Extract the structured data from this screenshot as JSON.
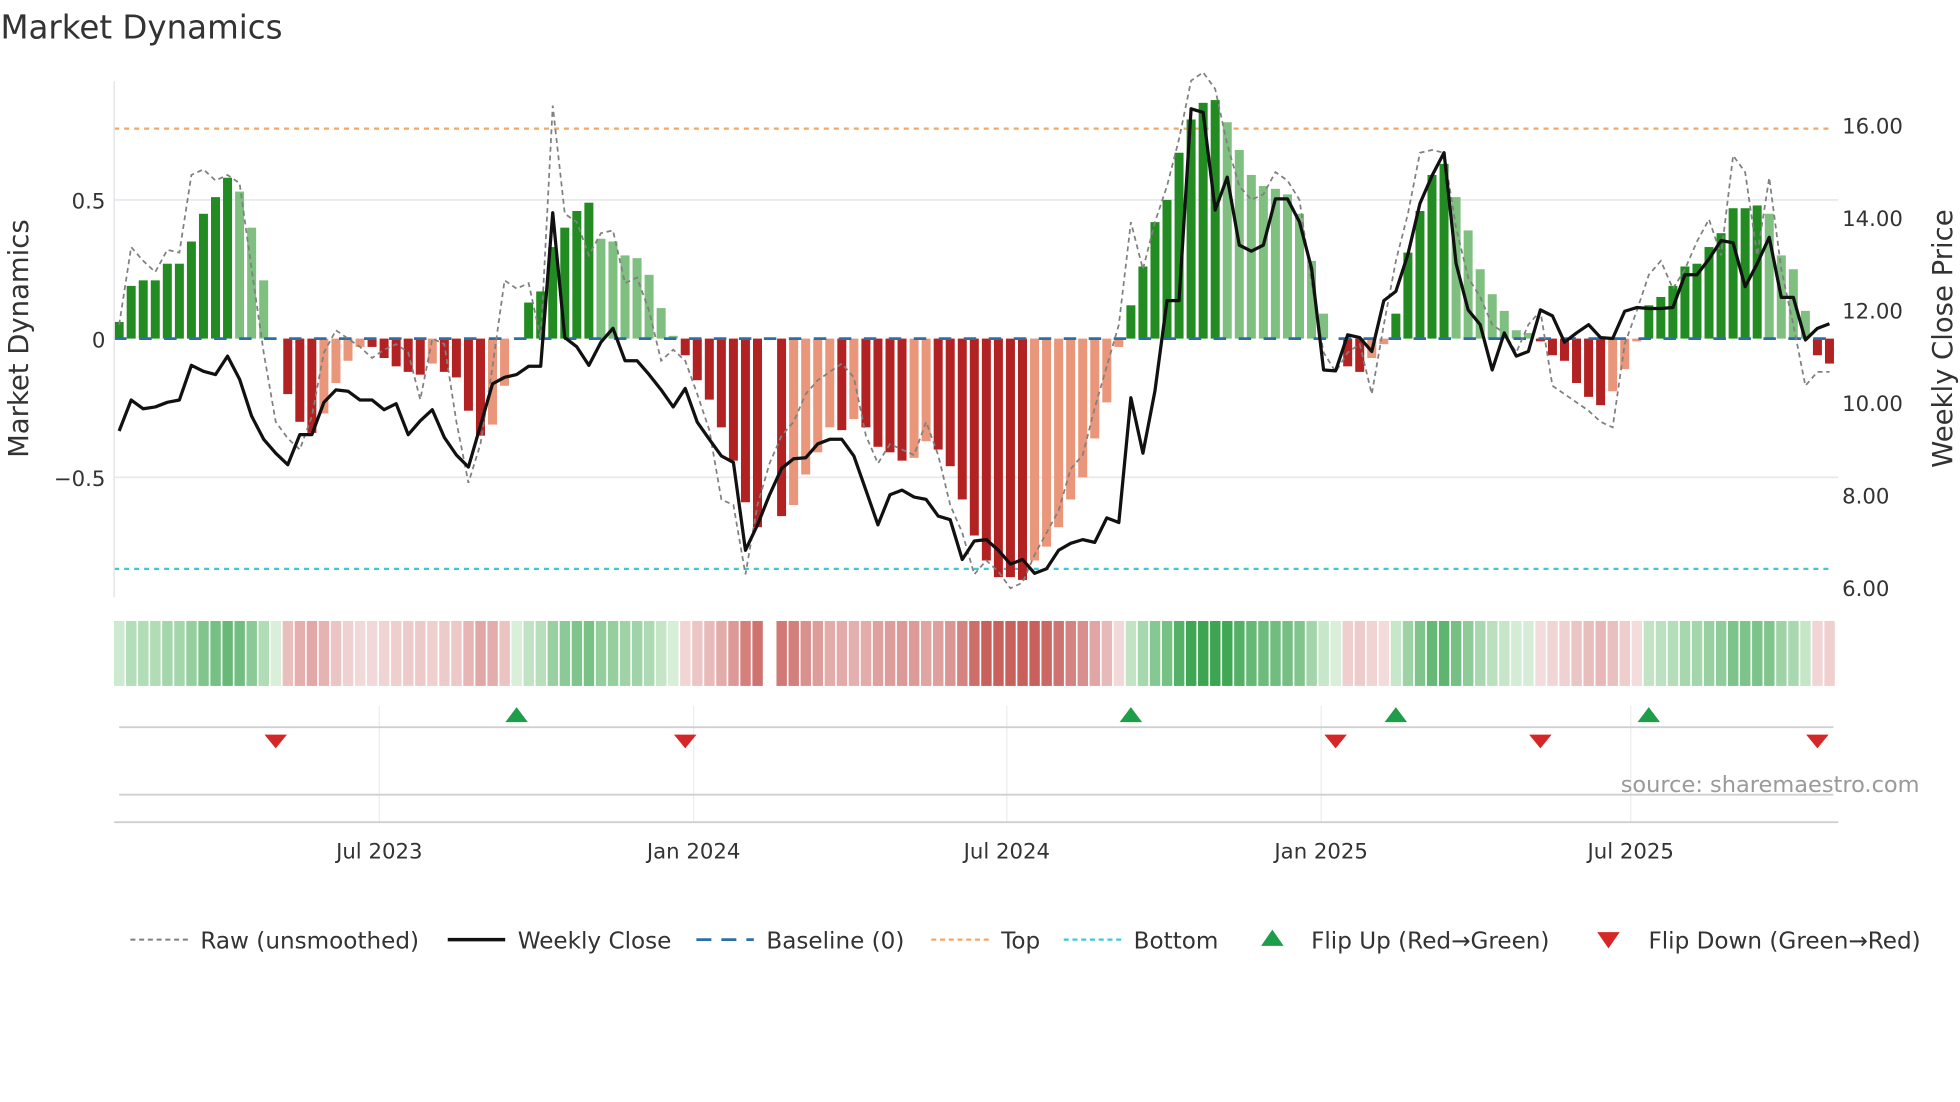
{
  "title": "Market Dynamics",
  "source": "source: sharemaestro.com",
  "colors": {
    "pos_strong": "#228b22",
    "pos_weak": "#7fbf7f",
    "neg_strong": "#b22222",
    "neg_weak": "#e9967a",
    "close": "#111111",
    "raw": "#808080",
    "baseline": "#2a6fa8",
    "top": "#f0a868",
    "bottom": "#3cc8d8",
    "flip_up": "#1f9e4a",
    "flip_down": "#d62728"
  },
  "chart_data": {
    "type": "bar",
    "title": "Market Dynamics",
    "xlabel": "",
    "ylabel": "Market Dynamics",
    "y2label": "Weekly Close Price",
    "x_unit": "week index (weekly, ~Feb 2023 to Oct 2025)",
    "ylim": [
      -0.93,
      0.93
    ],
    "y2lim": [
      5.7,
      17.0
    ],
    "top_level": 0.757,
    "bottom_level": -0.83,
    "baseline": 0,
    "y_ticks": [
      {
        "value": 0.5,
        "label": "0.5"
      },
      {
        "value": 0,
        "label": "0"
      },
      {
        "value": -0.5,
        "label": "−0.5"
      }
    ],
    "y2_ticks": [
      {
        "value": 16,
        "label": "16.00"
      },
      {
        "value": 14,
        "label": "14.00"
      },
      {
        "value": 12,
        "label": "12.00"
      },
      {
        "value": 10,
        "label": "10.00"
      },
      {
        "value": 8,
        "label": "8.00"
      },
      {
        "value": 6,
        "label": "6.00"
      }
    ],
    "x_ticks": [
      {
        "week": 21.6,
        "label": "Jul 2023"
      },
      {
        "week": 47.7,
        "label": "Jan 2024"
      },
      {
        "week": 73.7,
        "label": "Jul 2024"
      },
      {
        "week": 99.8,
        "label": "Jan 2025"
      },
      {
        "week": 125.5,
        "label": "Jul 2025"
      }
    ],
    "dynamics": [
      0.06,
      0.19,
      0.21,
      0.21,
      0.27,
      0.27,
      0.35,
      0.45,
      0.51,
      0.58,
      0.53,
      0.4,
      0.21,
      0,
      -0.2,
      -0.3,
      -0.34,
      -0.27,
      -0.16,
      -0.08,
      -0.03,
      -0.03,
      -0.07,
      -0.1,
      -0.12,
      -0.13,
      -0.09,
      -0.12,
      -0.14,
      -0.26,
      -0.35,
      -0.31,
      -0.17,
      0,
      0.13,
      0.17,
      0.33,
      0.4,
      0.46,
      0.49,
      0.36,
      0.35,
      0.3,
      0.29,
      0.23,
      0.11,
      0.01,
      -0.06,
      -0.15,
      -0.22,
      -0.32,
      -0.44,
      -0.59,
      -0.68,
      null,
      -0.64,
      -0.6,
      -0.49,
      -0.41,
      -0.32,
      -0.33,
      -0.29,
      -0.32,
      -0.39,
      -0.41,
      -0.44,
      -0.43,
      -0.37,
      -0.4,
      -0.46,
      -0.58,
      -0.71,
      -0.8,
      -0.86,
      -0.86,
      -0.87,
      -0.8,
      -0.75,
      -0.68,
      -0.58,
      -0.5,
      -0.36,
      -0.23,
      -0.03,
      0.12,
      0.26,
      0.42,
      0.5,
      0.67,
      0.79,
      0.85,
      0.86,
      0.78,
      0.68,
      0.59,
      0.55,
      0.54,
      0.52,
      0.45,
      0.28,
      0.09,
      0,
      -0.1,
      -0.12,
      -0.07,
      -0.02,
      0.09,
      0.31,
      0.46,
      0.59,
      0.63,
      0.51,
      0.39,
      0.25,
      0.16,
      0.1,
      0.03,
      0.02,
      -0.01,
      -0.06,
      -0.08,
      -0.16,
      -0.21,
      -0.24,
      -0.19,
      -0.11,
      -0.01,
      0.12,
      0.15,
      0.19,
      0.26,
      0.27,
      0.33,
      0.38,
      0.47,
      0.47,
      0.48,
      0.45,
      0.3,
      0.25,
      0.1,
      -0.06,
      -0.09
    ],
    "raw": [
      0.05,
      0.33,
      0.28,
      0.24,
      0.32,
      0.31,
      0.59,
      0.61,
      0.57,
      0.59,
      0.56,
      0.25,
      -0.05,
      -0.3,
      -0.36,
      -0.4,
      -0.28,
      -0.05,
      0.03,
      0.0,
      -0.03,
      -0.07,
      -0.04,
      -0.02,
      -0.05,
      -0.22,
      0.0,
      -0.02,
      -0.3,
      -0.52,
      -0.38,
      -0.1,
      0.21,
      0.18,
      0.2,
      0.0,
      0.84,
      0.45,
      0.42,
      0.3,
      0.38,
      0.39,
      0.2,
      0.22,
      0.1,
      -0.08,
      -0.04,
      -0.08,
      -0.2,
      -0.33,
      -0.58,
      -0.6,
      -0.85,
      -0.6,
      -0.45,
      -0.35,
      -0.3,
      -0.2,
      -0.15,
      -0.12,
      -0.09,
      -0.14,
      -0.35,
      -0.45,
      -0.38,
      -0.4,
      -0.42,
      -0.3,
      -0.42,
      -0.6,
      -0.7,
      -0.85,
      -0.8,
      -0.84,
      -0.9,
      -0.88,
      -0.78,
      -0.7,
      -0.62,
      -0.47,
      -0.42,
      -0.25,
      -0.1,
      0.05,
      0.42,
      0.25,
      0.42,
      0.55,
      0.72,
      0.93,
      0.96,
      0.9,
      0.7,
      0.55,
      0.5,
      0.52,
      0.6,
      0.57,
      0.5,
      0.2,
      -0.05,
      -0.12,
      -0.05,
      -0.02,
      -0.2,
      0.05,
      0.28,
      0.45,
      0.67,
      0.68,
      0.67,
      0.4,
      0.22,
      0.15,
      0.05,
      0.02,
      -0.05,
      0.05,
      0.1,
      -0.17,
      -0.2,
      -0.23,
      -0.26,
      -0.3,
      -0.32,
      -0.02,
      0.1,
      0.23,
      0.28,
      0.18,
      0.25,
      0.35,
      0.43,
      0.3,
      0.66,
      0.6,
      0.3,
      0.58,
      0.25,
      0.05,
      -0.17,
      -0.12,
      -0.12
    ],
    "close": [
      9.38,
      10.05,
      9.86,
      9.9,
      10.0,
      10.05,
      10.8,
      10.67,
      10.6,
      11.0,
      10.5,
      9.7,
      9.2,
      8.9,
      8.65,
      9.3,
      9.3,
      10.0,
      10.27,
      10.24,
      10.05,
      10.05,
      9.84,
      9.97,
      9.3,
      9.6,
      9.84,
      9.24,
      8.86,
      8.6,
      9.5,
      10.4,
      10.54,
      10.6,
      10.78,
      10.78,
      14.1,
      11.4,
      11.2,
      10.8,
      11.3,
      11.6,
      10.9,
      10.9,
      10.6,
      10.27,
      9.9,
      10.3,
      9.57,
      9.2,
      8.84,
      8.7,
      6.8,
      7.35,
      8.0,
      8.57,
      8.78,
      8.8,
      9.1,
      9.2,
      9.2,
      8.84,
      8.1,
      7.35,
      8.0,
      8.1,
      7.95,
      7.9,
      7.54,
      7.46,
      6.6,
      7.0,
      7.03,
      6.8,
      6.5,
      6.6,
      6.3,
      6.4,
      6.8,
      6.95,
      7.03,
      6.97,
      7.5,
      7.4,
      10.1,
      8.9,
      10.25,
      12.2,
      12.2,
      16.35,
      16.27,
      14.16,
      14.87,
      13.4,
      13.27,
      13.4,
      14.4,
      14.4,
      13.9,
      12.9,
      10.7,
      10.68,
      11.46,
      11.4,
      11.1,
      12.2,
      12.4,
      13.2,
      14.3,
      14.9,
      15.4,
      13.0,
      12.0,
      11.68,
      10.7,
      11.5,
      11.0,
      11.1,
      12.0,
      11.87,
      11.3,
      11.5,
      11.68,
      11.4,
      11.38,
      11.97,
      12.05,
      12.03,
      12.03,
      12.05,
      12.76,
      12.76,
      13.1,
      13.5,
      13.45,
      12.5,
      13.0,
      13.57,
      12.27,
      12.27,
      11.35,
      11.6,
      11.7
    ],
    "flip_up_weeks": [
      33,
      84,
      106,
      127
    ],
    "flip_down_weeks": [
      13,
      47,
      101,
      118,
      141
    ],
    "legend": {
      "placement": "bottom",
      "items": [
        {
          "key": "raw",
          "label": "Raw (unsmoothed)"
        },
        {
          "key": "close",
          "label": "Weekly Close"
        },
        {
          "key": "baseline",
          "label": "Baseline (0)"
        },
        {
          "key": "top",
          "label": "Top"
        },
        {
          "key": "bottom",
          "label": "Bottom"
        },
        {
          "key": "flip_up",
          "label": "Flip Up (Red→Green)"
        },
        {
          "key": "flip_down",
          "label": "Flip Down (Green→Red)"
        }
      ]
    }
  }
}
